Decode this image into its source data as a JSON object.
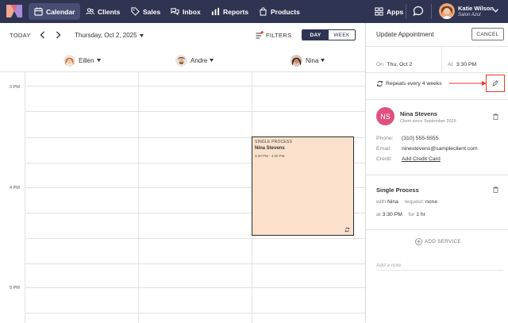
{
  "colors": {
    "nav_bg": "#2f3452",
    "accent_red": "#e53b2c",
    "appt_fill": "#fbe1cb",
    "client_badge": "#e0507e"
  },
  "nav": {
    "logo_icon": "m-logo-icon",
    "items": [
      {
        "label": "Calendar",
        "icon": "calendar-icon",
        "active": true
      },
      {
        "label": "Clients",
        "icon": "users-icon"
      },
      {
        "label": "Sales",
        "icon": "tag-icon"
      },
      {
        "label": "Inbox",
        "icon": "chat-bubbles-icon"
      },
      {
        "label": "Reports",
        "icon": "bar-chart-icon"
      },
      {
        "label": "Products",
        "icon": "shopping-bag-icon"
      }
    ],
    "apps_label": "Apps",
    "user": {
      "name": "Katie Wilson",
      "location": "Salon Azul"
    }
  },
  "toolbar": {
    "today": "TODAY",
    "date": "Thursday, Oct 2, 2025",
    "filters": "FILTERS",
    "view_day": "DAY",
    "view_week": "WEEK"
  },
  "staff": [
    {
      "name": "Eillen"
    },
    {
      "name": "Andre"
    },
    {
      "name": "Nina"
    }
  ],
  "times": [
    "3 PM",
    "4 PM",
    "5 PM"
  ],
  "appointment": {
    "service": "SINGLE PROCESS",
    "client": "Nina Stevens",
    "time": "3:30 PM - 4:30 PM"
  },
  "panel": {
    "title": "Update Appointment",
    "cancel": "CANCEL",
    "on_label": "On",
    "on_value": "Thu, Oct 2",
    "at_label": "At",
    "at_value": "3:30 PM",
    "repeat": "Repeats every 4 weeks",
    "client": {
      "initials": "NS",
      "name": "Nina Stevens",
      "since": "Client since September 2025",
      "phone_label": "Phone:",
      "phone": "(310) 555-5555",
      "email_label": "Email:",
      "email": "ninestevens@sampleclient.com",
      "credit_label": "Credit:",
      "credit_link": "Add Credit Card"
    },
    "service": {
      "title": "Single Process",
      "with_label": "with",
      "with_value": "Nina",
      "request_label": "request:",
      "request_value": "none",
      "at_label": "at",
      "at_value": "3:30 PM",
      "for_label": "for",
      "for_value": "1 hr"
    },
    "add_service": "ADD SERVICE",
    "note_placeholder": "Add a note"
  }
}
